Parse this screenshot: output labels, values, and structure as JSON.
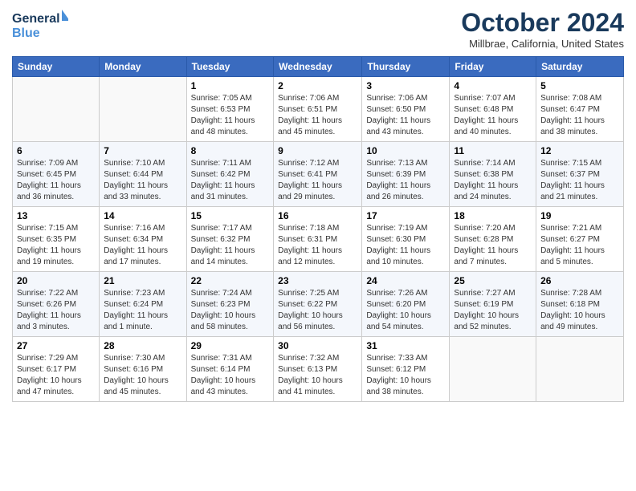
{
  "header": {
    "logo_line1": "General",
    "logo_line2": "Blue",
    "month_title": "October 2024",
    "subtitle": "Millbrae, California, United States"
  },
  "days_of_week": [
    "Sunday",
    "Monday",
    "Tuesday",
    "Wednesday",
    "Thursday",
    "Friday",
    "Saturday"
  ],
  "weeks": [
    {
      "cells": [
        {
          "day": "",
          "info": ""
        },
        {
          "day": "",
          "info": ""
        },
        {
          "day": "1",
          "info": "Sunrise: 7:05 AM\nSunset: 6:53 PM\nDaylight: 11 hours and 48 minutes."
        },
        {
          "day": "2",
          "info": "Sunrise: 7:06 AM\nSunset: 6:51 PM\nDaylight: 11 hours and 45 minutes."
        },
        {
          "day": "3",
          "info": "Sunrise: 7:06 AM\nSunset: 6:50 PM\nDaylight: 11 hours and 43 minutes."
        },
        {
          "day": "4",
          "info": "Sunrise: 7:07 AM\nSunset: 6:48 PM\nDaylight: 11 hours and 40 minutes."
        },
        {
          "day": "5",
          "info": "Sunrise: 7:08 AM\nSunset: 6:47 PM\nDaylight: 11 hours and 38 minutes."
        }
      ]
    },
    {
      "cells": [
        {
          "day": "6",
          "info": "Sunrise: 7:09 AM\nSunset: 6:45 PM\nDaylight: 11 hours and 36 minutes."
        },
        {
          "day": "7",
          "info": "Sunrise: 7:10 AM\nSunset: 6:44 PM\nDaylight: 11 hours and 33 minutes."
        },
        {
          "day": "8",
          "info": "Sunrise: 7:11 AM\nSunset: 6:42 PM\nDaylight: 11 hours and 31 minutes."
        },
        {
          "day": "9",
          "info": "Sunrise: 7:12 AM\nSunset: 6:41 PM\nDaylight: 11 hours and 29 minutes."
        },
        {
          "day": "10",
          "info": "Sunrise: 7:13 AM\nSunset: 6:39 PM\nDaylight: 11 hours and 26 minutes."
        },
        {
          "day": "11",
          "info": "Sunrise: 7:14 AM\nSunset: 6:38 PM\nDaylight: 11 hours and 24 minutes."
        },
        {
          "day": "12",
          "info": "Sunrise: 7:15 AM\nSunset: 6:37 PM\nDaylight: 11 hours and 21 minutes."
        }
      ]
    },
    {
      "cells": [
        {
          "day": "13",
          "info": "Sunrise: 7:15 AM\nSunset: 6:35 PM\nDaylight: 11 hours and 19 minutes."
        },
        {
          "day": "14",
          "info": "Sunrise: 7:16 AM\nSunset: 6:34 PM\nDaylight: 11 hours and 17 minutes."
        },
        {
          "day": "15",
          "info": "Sunrise: 7:17 AM\nSunset: 6:32 PM\nDaylight: 11 hours and 14 minutes."
        },
        {
          "day": "16",
          "info": "Sunrise: 7:18 AM\nSunset: 6:31 PM\nDaylight: 11 hours and 12 minutes."
        },
        {
          "day": "17",
          "info": "Sunrise: 7:19 AM\nSunset: 6:30 PM\nDaylight: 11 hours and 10 minutes."
        },
        {
          "day": "18",
          "info": "Sunrise: 7:20 AM\nSunset: 6:28 PM\nDaylight: 11 hours and 7 minutes."
        },
        {
          "day": "19",
          "info": "Sunrise: 7:21 AM\nSunset: 6:27 PM\nDaylight: 11 hours and 5 minutes."
        }
      ]
    },
    {
      "cells": [
        {
          "day": "20",
          "info": "Sunrise: 7:22 AM\nSunset: 6:26 PM\nDaylight: 11 hours and 3 minutes."
        },
        {
          "day": "21",
          "info": "Sunrise: 7:23 AM\nSunset: 6:24 PM\nDaylight: 11 hours and 1 minute."
        },
        {
          "day": "22",
          "info": "Sunrise: 7:24 AM\nSunset: 6:23 PM\nDaylight: 10 hours and 58 minutes."
        },
        {
          "day": "23",
          "info": "Sunrise: 7:25 AM\nSunset: 6:22 PM\nDaylight: 10 hours and 56 minutes."
        },
        {
          "day": "24",
          "info": "Sunrise: 7:26 AM\nSunset: 6:20 PM\nDaylight: 10 hours and 54 minutes."
        },
        {
          "day": "25",
          "info": "Sunrise: 7:27 AM\nSunset: 6:19 PM\nDaylight: 10 hours and 52 minutes."
        },
        {
          "day": "26",
          "info": "Sunrise: 7:28 AM\nSunset: 6:18 PM\nDaylight: 10 hours and 49 minutes."
        }
      ]
    },
    {
      "cells": [
        {
          "day": "27",
          "info": "Sunrise: 7:29 AM\nSunset: 6:17 PM\nDaylight: 10 hours and 47 minutes."
        },
        {
          "day": "28",
          "info": "Sunrise: 7:30 AM\nSunset: 6:16 PM\nDaylight: 10 hours and 45 minutes."
        },
        {
          "day": "29",
          "info": "Sunrise: 7:31 AM\nSunset: 6:14 PM\nDaylight: 10 hours and 43 minutes."
        },
        {
          "day": "30",
          "info": "Sunrise: 7:32 AM\nSunset: 6:13 PM\nDaylight: 10 hours and 41 minutes."
        },
        {
          "day": "31",
          "info": "Sunrise: 7:33 AM\nSunset: 6:12 PM\nDaylight: 10 hours and 38 minutes."
        },
        {
          "day": "",
          "info": ""
        },
        {
          "day": "",
          "info": ""
        }
      ]
    }
  ]
}
